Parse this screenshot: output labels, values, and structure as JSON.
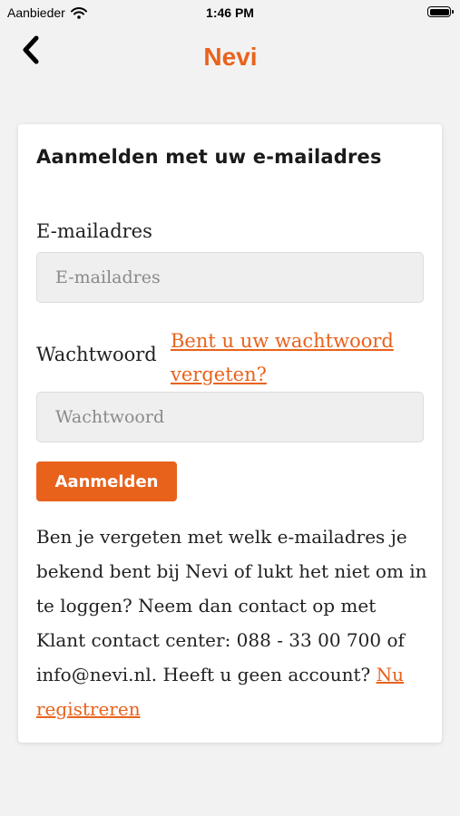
{
  "status_bar": {
    "carrier": "Aanbieder",
    "time": "1:46 PM"
  },
  "nav": {
    "logo_text": "Nevi",
    "brand_color": "#e8621c"
  },
  "login_form": {
    "title": "Aanmelden met uw e-mailadres",
    "email_label": "E-mailadres",
    "email_placeholder": "E-mailadres",
    "email_value": "",
    "password_label": "Wachtwoord",
    "forgot_link": "Bent u uw wachtwoord vergeten?",
    "password_placeholder": "Wachtwoord",
    "password_value": "",
    "submit_label": "Aanmelden"
  },
  "info": {
    "text": "Ben je vergeten met welk e-mailadres je bekend bent bij Nevi of lukt het niet om in te loggen? Neem dan contact op met Klant contact center: 088 - 33 00 700 of info@nevi.nl. Heeft u geen account?",
    "register_link": "Nu registreren"
  },
  "icons": [
    "wifi-icon",
    "battery-icon",
    "back-chevron-icon"
  ]
}
